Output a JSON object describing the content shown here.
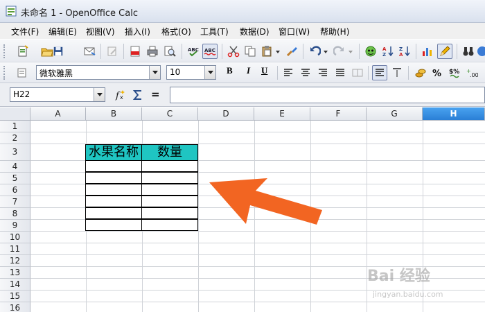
{
  "window": {
    "title": "未命名 1 - OpenOffice Calc"
  },
  "menu": {
    "items": [
      "文件(F)",
      "编辑(E)",
      "视图(V)",
      "插入(I)",
      "格式(O)",
      "工具(T)",
      "数据(D)",
      "窗口(W)",
      "帮助(H)"
    ]
  },
  "formatting": {
    "font_name": "微软雅黑",
    "font_size": "10",
    "bold_label": "B",
    "italic_label": "I",
    "underline_label": "U"
  },
  "formula_bar": {
    "name_box": "H22",
    "equals_label": "=",
    "content": ""
  },
  "sheet": {
    "columns": [
      "A",
      "B",
      "C",
      "D",
      "E",
      "F",
      "G",
      "H"
    ],
    "selected_column": "H",
    "rows": [
      "1",
      "2",
      "3",
      "4",
      "5",
      "6",
      "7",
      "8",
      "9",
      "10",
      "11",
      "12",
      "13",
      "14",
      "15",
      "16"
    ],
    "table": {
      "header_b": "水果名称",
      "header_c": "数量",
      "header_color": "#1fc5c2"
    }
  },
  "annotation": {
    "arrow_color": "#f26522"
  },
  "watermark": {
    "logo": "Bai 经验",
    "url": "jingyan.baidu.com"
  }
}
